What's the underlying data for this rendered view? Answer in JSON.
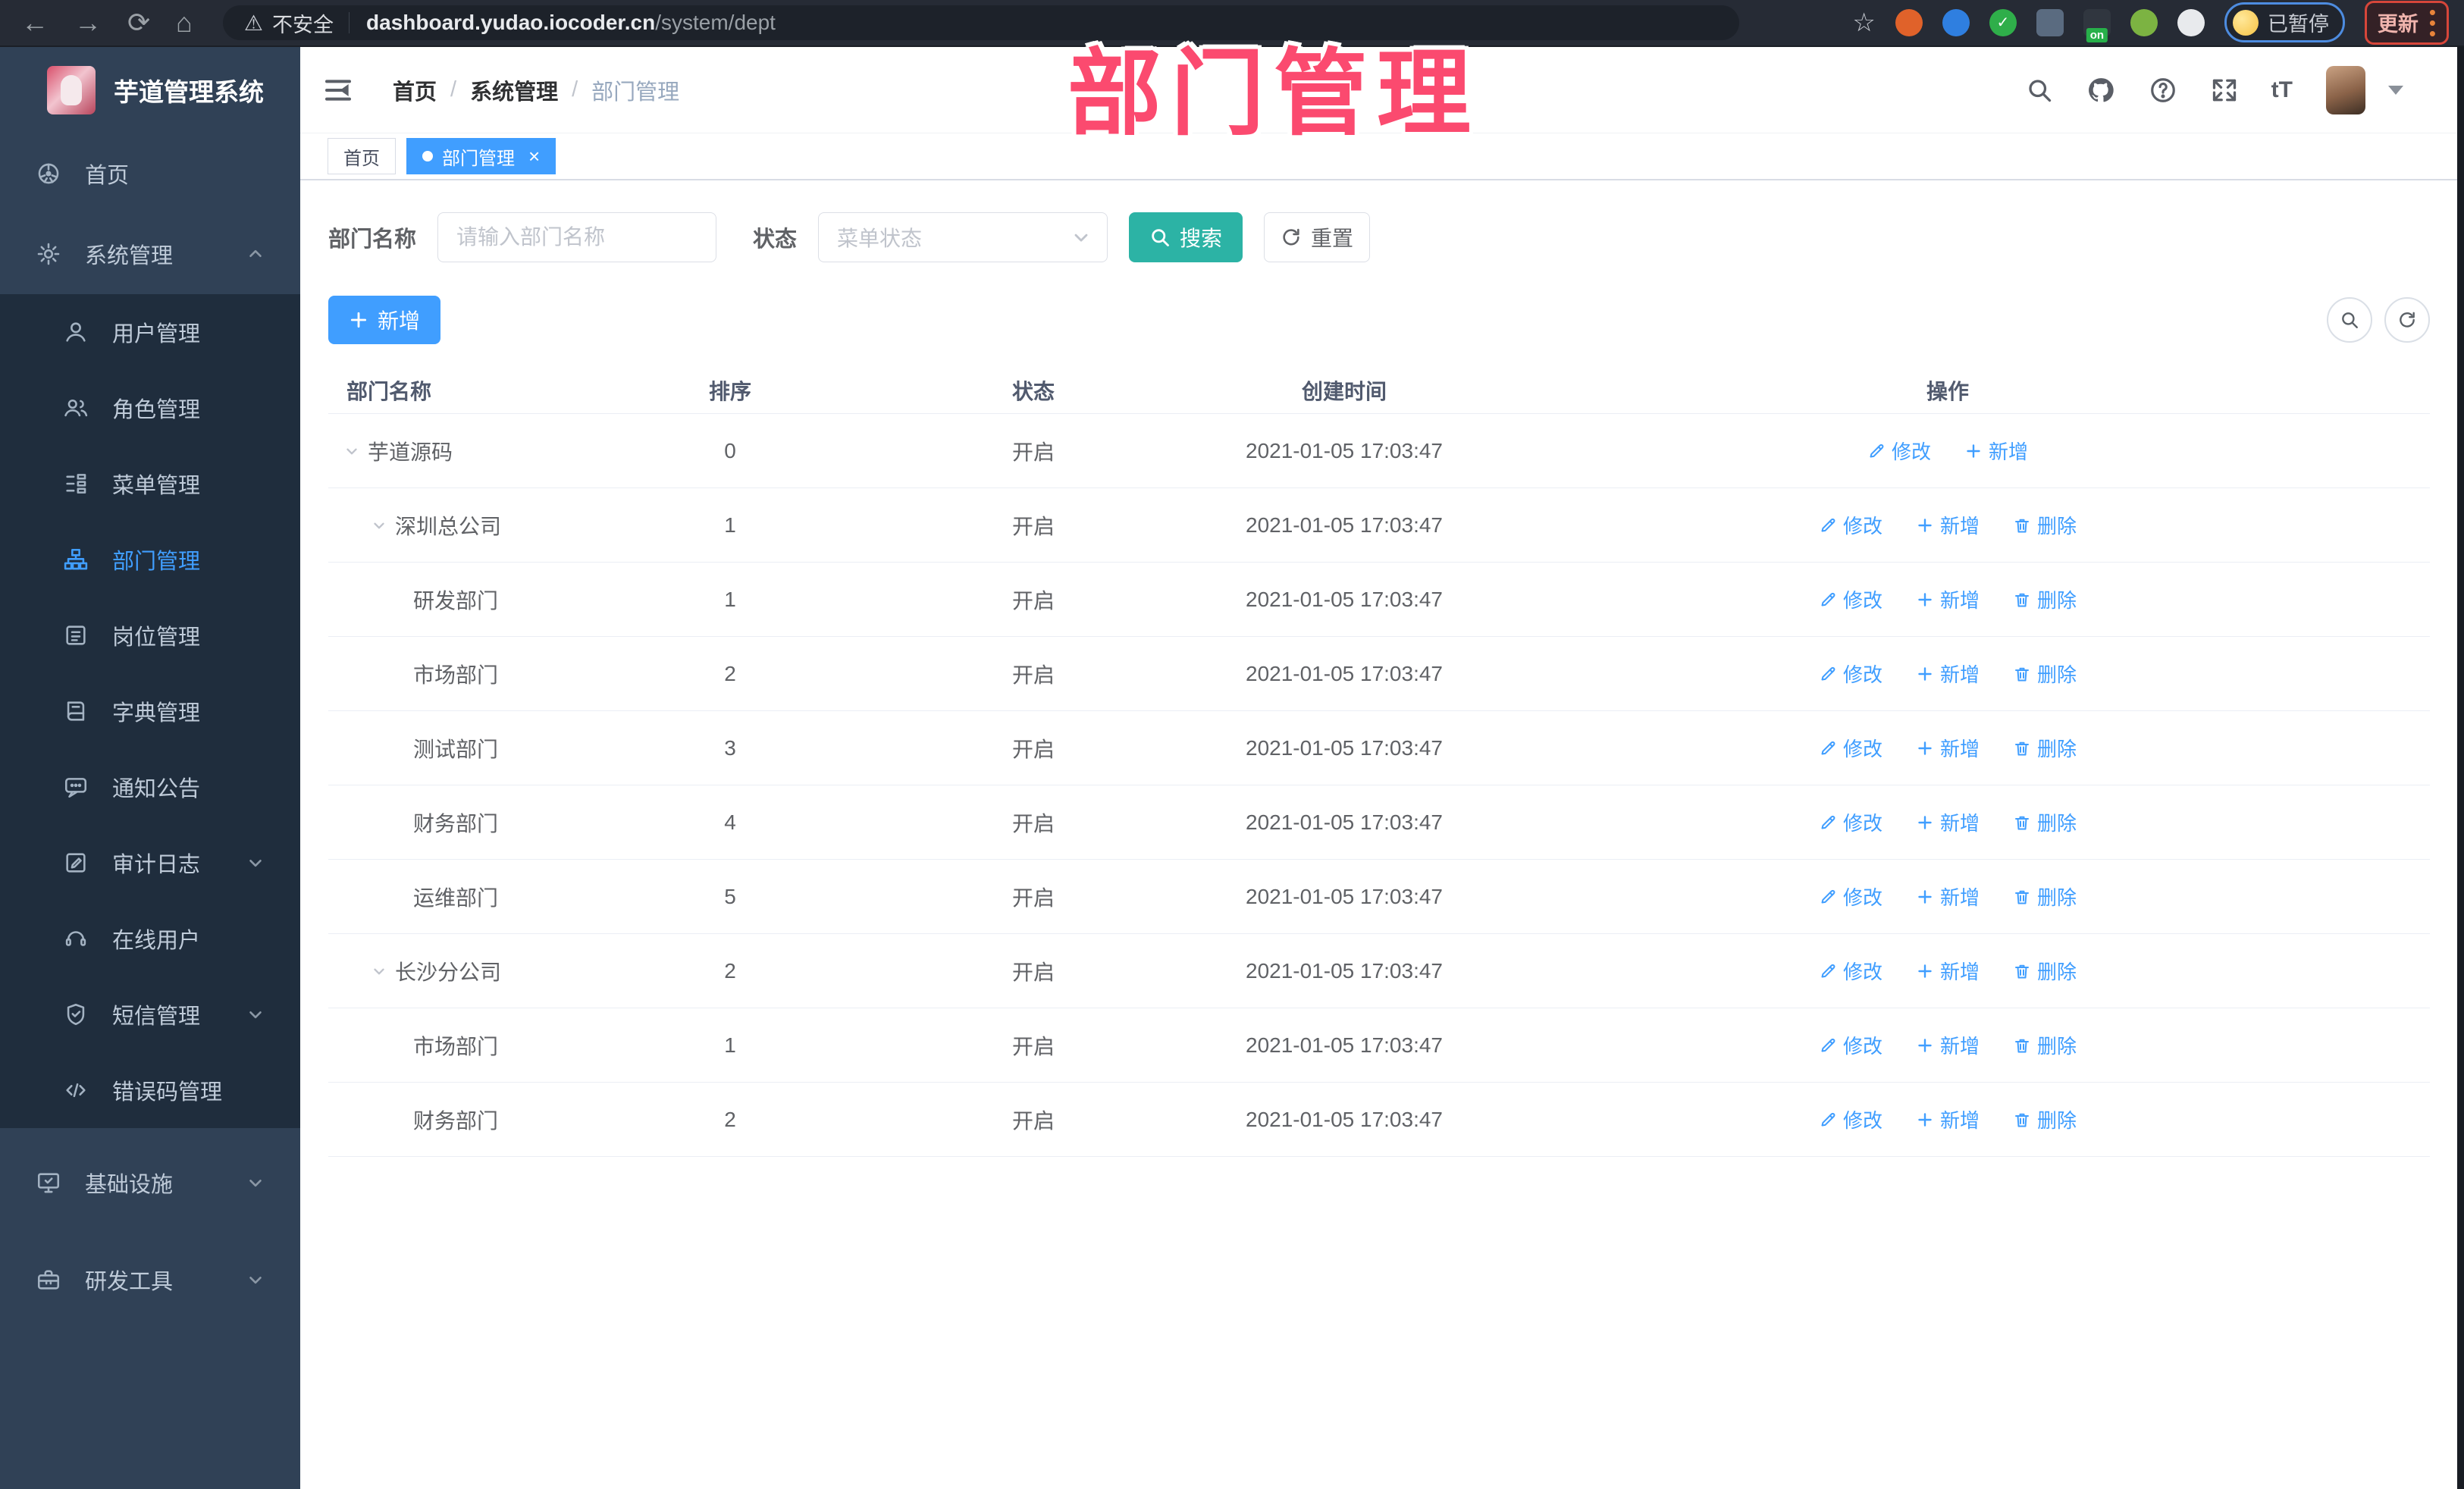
{
  "colors": {
    "accent_blue": "#409eff",
    "search_teal": "#2cb3a5",
    "sidebar_bg": "#304156",
    "submenu_bg": "#1f2d3d",
    "sidebar_text": "#bfcbd9",
    "overlay_pink": "#fb4a6f",
    "browser_bar_bg": "#262b35",
    "active_tab_bg": "#409eff",
    "breadcrumb_last": "#97a8be"
  },
  "overlay": {
    "title": "部门管理"
  },
  "browser": {
    "nav_icons": [
      "back-arrow",
      "forward-arrow",
      "reload",
      "home"
    ],
    "security_label": "不安全",
    "url_host": "dashboard.yudao.iocoder.cn",
    "url_path": "/system/dept",
    "star_icon": "bookmark-star",
    "extensions": [
      {
        "name": "orange-gear-extension",
        "color": "#e0622a",
        "shape": "round"
      },
      {
        "name": "blue-drop-extension",
        "color": "#2f7fe0",
        "shape": "round"
      },
      {
        "name": "green-check-extension",
        "color": "#2fae4a",
        "shape": "round",
        "glyph": "✓"
      },
      {
        "name": "grid-extension",
        "color": "#5a6b80",
        "shape": "square"
      },
      {
        "name": "list-extension",
        "color": "#30363f",
        "shape": "square",
        "badge": "on"
      },
      {
        "name": "green-person-extension",
        "color": "#7cb342",
        "shape": "round"
      },
      {
        "name": "puzzle-extension",
        "color": "#e8eaed",
        "shape": "round"
      }
    ],
    "paused_badge": "已暂停",
    "update_button": "更新"
  },
  "sidebar": {
    "logo_title": "芋道管理系统",
    "items": [
      {
        "label": "首页",
        "icon": "dashboard",
        "group": "root"
      },
      {
        "label": "系统管理",
        "icon": "gear",
        "group": "root",
        "arrow": "up"
      },
      {
        "label": "用户管理",
        "icon": "user",
        "group": "sub"
      },
      {
        "label": "角色管理",
        "icon": "users",
        "group": "sub"
      },
      {
        "label": "菜单管理",
        "icon": "menutree",
        "group": "sub"
      },
      {
        "label": "部门管理",
        "icon": "dept",
        "group": "sub",
        "active": true
      },
      {
        "label": "岗位管理",
        "icon": "idcard",
        "group": "sub"
      },
      {
        "label": "字典管理",
        "icon": "book",
        "group": "sub"
      },
      {
        "label": "通知公告",
        "icon": "notice",
        "group": "sub"
      },
      {
        "label": "审计日志",
        "icon": "audit",
        "group": "sub",
        "arrow": "down"
      },
      {
        "label": "在线用户",
        "icon": "online",
        "group": "sub"
      },
      {
        "label": "短信管理",
        "icon": "shield",
        "group": "sub",
        "arrow": "down"
      },
      {
        "label": "错误码管理",
        "icon": "code",
        "group": "sub"
      },
      {
        "label": "基础设施",
        "icon": "monitor",
        "group": "root2",
        "arrow": "down"
      },
      {
        "label": "研发工具",
        "icon": "toolbox",
        "group": "root2",
        "arrow": "down"
      }
    ]
  },
  "header": {
    "breadcrumb": [
      "首页",
      "系统管理",
      "部门管理"
    ],
    "right_icons": [
      "search-icon",
      "github-icon",
      "question-icon",
      "fullscreen-icon",
      "font-size-icon",
      "avatar",
      "caret-down-icon"
    ],
    "font_size_glyph": "tT"
  },
  "tabs": [
    {
      "label": "首页",
      "active": false
    },
    {
      "label": "部门管理",
      "active": true,
      "closable": true
    }
  ],
  "filters": {
    "name_label": "部门名称",
    "name_placeholder": "请输入部门名称",
    "status_label": "状态",
    "status_placeholder": "菜单状态",
    "search_button": "搜索",
    "reset_button": "重置"
  },
  "toolbar": {
    "add_button": "新增"
  },
  "table": {
    "columns": [
      "部门名称",
      "排序",
      "状态",
      "创建时间",
      "操作"
    ],
    "action_labels": {
      "edit": "修改",
      "add": "新增",
      "delete": "删除"
    },
    "rows": [
      {
        "name": "芋道源码",
        "level": 0,
        "expandable": true,
        "order": "0",
        "status": "开启",
        "created": "2021-01-05 17:03:47",
        "can_delete": false
      },
      {
        "name": "深圳总公司",
        "level": 1,
        "expandable": true,
        "order": "1",
        "status": "开启",
        "created": "2021-01-05 17:03:47",
        "can_delete": true
      },
      {
        "name": "研发部门",
        "level": 2,
        "expandable": false,
        "order": "1",
        "status": "开启",
        "created": "2021-01-05 17:03:47",
        "can_delete": true
      },
      {
        "name": "市场部门",
        "level": 2,
        "expandable": false,
        "order": "2",
        "status": "开启",
        "created": "2021-01-05 17:03:47",
        "can_delete": true
      },
      {
        "name": "测试部门",
        "level": 2,
        "expandable": false,
        "order": "3",
        "status": "开启",
        "created": "2021-01-05 17:03:47",
        "can_delete": true
      },
      {
        "name": "财务部门",
        "level": 2,
        "expandable": false,
        "order": "4",
        "status": "开启",
        "created": "2021-01-05 17:03:47",
        "can_delete": true
      },
      {
        "name": "运维部门",
        "level": 2,
        "expandable": false,
        "order": "5",
        "status": "开启",
        "created": "2021-01-05 17:03:47",
        "can_delete": true
      },
      {
        "name": "长沙分公司",
        "level": 1,
        "expandable": true,
        "order": "2",
        "status": "开启",
        "created": "2021-01-05 17:03:47",
        "can_delete": true
      },
      {
        "name": "市场部门",
        "level": 2,
        "expandable": false,
        "order": "1",
        "status": "开启",
        "created": "2021-01-05 17:03:47",
        "can_delete": true
      },
      {
        "name": "财务部门",
        "level": 2,
        "expandable": false,
        "order": "2",
        "status": "开启",
        "created": "2021-01-05 17:03:47",
        "can_delete": true
      }
    ]
  }
}
